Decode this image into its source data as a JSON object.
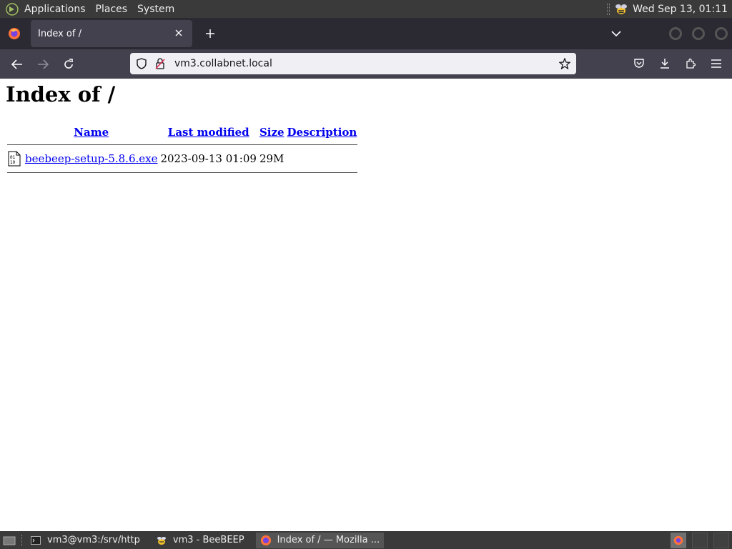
{
  "top_panel": {
    "menus": [
      "Applications",
      "Places",
      "System"
    ],
    "clock": "Wed Sep 13, 01:11"
  },
  "browser": {
    "tab_title": "Index of /",
    "url": "vm3.collabnet.local"
  },
  "page": {
    "heading": "Index of /",
    "columns": [
      "Name",
      "Last modified",
      "Size",
      "Description"
    ],
    "rows": [
      {
        "name": "beebeep-setup-5.8.6.exe",
        "last_modified": "2023-09-13 01:09",
        "size": "29M",
        "description": ""
      }
    ]
  },
  "taskbar": {
    "tasks": [
      {
        "label": "vm3@vm3:/srv/http",
        "icon": "terminal-icon"
      },
      {
        "label": "vm3 - BeeBEEP",
        "icon": "bee-icon"
      },
      {
        "label": "Index of / — Mozilla ...",
        "icon": "firefox-icon",
        "active": true
      }
    ]
  },
  "colors": {
    "panel_bg": "#3a3a3a",
    "tabstrip_bg": "#2b2a33",
    "toolbar_bg": "#42414d",
    "link": "#0000ee"
  }
}
